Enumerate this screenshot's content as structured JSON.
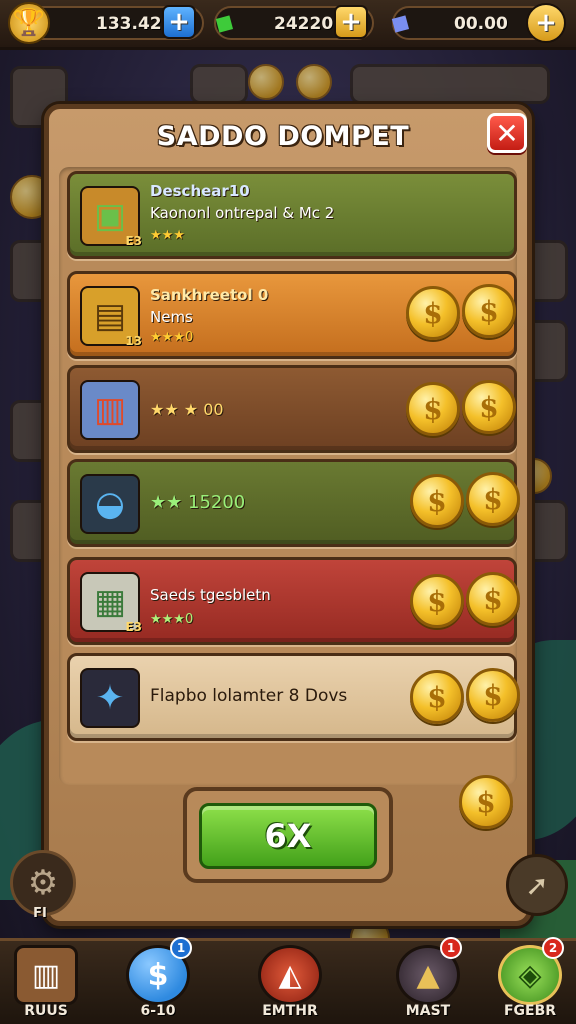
{
  "topbar": {
    "resources": [
      {
        "name": "trophy",
        "icon": "🏆",
        "value": "133.423",
        "button": "+",
        "button_style": "blue"
      },
      {
        "name": "emerald",
        "icon": "◆",
        "value": "24220",
        "button": "+",
        "button_style": "gold"
      },
      {
        "name": "crystal",
        "icon": "◆",
        "value": "00.00",
        "button": "+",
        "button_style": "gold"
      }
    ]
  },
  "dialog": {
    "title": "SADDO DOMPET",
    "close_label": "✕",
    "items": [
      {
        "style": "green",
        "icon": "▣",
        "badge": "E3",
        "name": "Deschear10",
        "desc": "Kaononl ontrepal & Mc 2",
        "stars": "★★★",
        "coins": 0
      },
      {
        "style": "orange",
        "icon": "▤",
        "badge": "13",
        "name": "Sankhreetol 0",
        "desc": "Nems",
        "stars": "★★★0",
        "coins": 2
      },
      {
        "style": "brown",
        "icon": "▥",
        "badge": "",
        "name": "",
        "desc": "",
        "stars": "★★ ★ 00",
        "coins": 2
      },
      {
        "style": "olive",
        "icon": "◒",
        "badge": "",
        "name": "",
        "desc": "",
        "stars": "★★ 15200",
        "coins": 2
      },
      {
        "style": "red",
        "icon": "▦",
        "badge": "E3",
        "name": "Saeds tgesbletn",
        "desc": "",
        "stars": "★★★0",
        "coins": 2
      },
      {
        "style": "cream",
        "icon": "✦",
        "badge": "",
        "name": "Flapbo lolamter 8 Dovs",
        "desc": "",
        "stars": "",
        "coins": 2
      }
    ],
    "confirm_label": "6X",
    "coin_symbol": "$"
  },
  "side": {
    "settings_label": "FI",
    "settings_icon": "⚙",
    "right_icon": "➚"
  },
  "bottomnav": [
    {
      "label": "RUUS",
      "icon": "▥",
      "color": "#8a5a32",
      "badge": ""
    },
    {
      "label": "6-10",
      "icon": "$",
      "color": "#2f8ae0",
      "badge": "1",
      "badge_style": "blue"
    },
    {
      "label": "EMTHR",
      "icon": "◭",
      "color": "#b8321e",
      "badge": ""
    },
    {
      "label": "MAST",
      "icon": "▲",
      "color": "#4a3a48",
      "badge": "1"
    },
    {
      "label": "FGEBR",
      "icon": "◈",
      "color": "#4aa028",
      "badge": "2"
    }
  ],
  "colors": {
    "accent_green": "#43a11a",
    "close_red": "#c41d14",
    "coin_gold": "#f4c02a",
    "panel_wood": "#c79a6b"
  }
}
